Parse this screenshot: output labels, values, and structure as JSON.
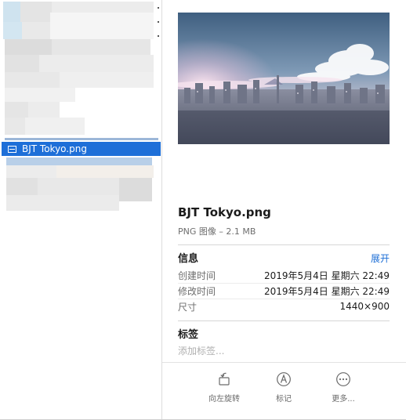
{
  "sidebar": {
    "selected_file": "BJT Tokyo.png"
  },
  "preview": {
    "file_name": "BJT Tokyo.png",
    "file_kind": "PNG 图像 – 2.1 MB",
    "info": {
      "title": "信息",
      "expand_label": "展开",
      "rows": [
        {
          "key": "创建时间",
          "value": "2019年5月4日 星期六 22:49"
        },
        {
          "key": "修改时间",
          "value": "2019年5月4日 星期六 22:49"
        },
        {
          "key": "尺寸",
          "value": "1440×900"
        }
      ]
    },
    "tags": {
      "title": "标签",
      "placeholder": "添加标签..."
    },
    "actions": [
      {
        "label": "向左旋转",
        "icon": "rotate-left-icon"
      },
      {
        "label": "标记",
        "icon": "markup-icon"
      },
      {
        "label": "更多...",
        "icon": "more-icon"
      }
    ]
  },
  "colors": {
    "accent": "#1e6fd8",
    "link": "#1c6ed6"
  }
}
